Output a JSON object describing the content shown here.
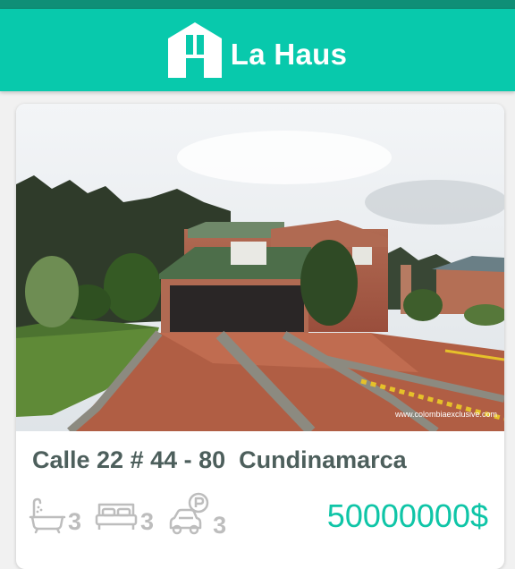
{
  "header": {
    "brand": "La Haus",
    "logo_icon": "house-h-logo-icon",
    "accent_color": "#08c9ac"
  },
  "listing": {
    "photo_watermark": "www.colombiaexclusive.com",
    "address": "Calle 22 # 44 - 80  Cundinamarca",
    "features": [
      {
        "icon": "bathtub-icon",
        "count": "3"
      },
      {
        "icon": "bed-icon",
        "count": "3"
      },
      {
        "icon": "parking-icon",
        "count": "3"
      }
    ],
    "price": "50000000$",
    "price_color": "#0fc5a7"
  }
}
